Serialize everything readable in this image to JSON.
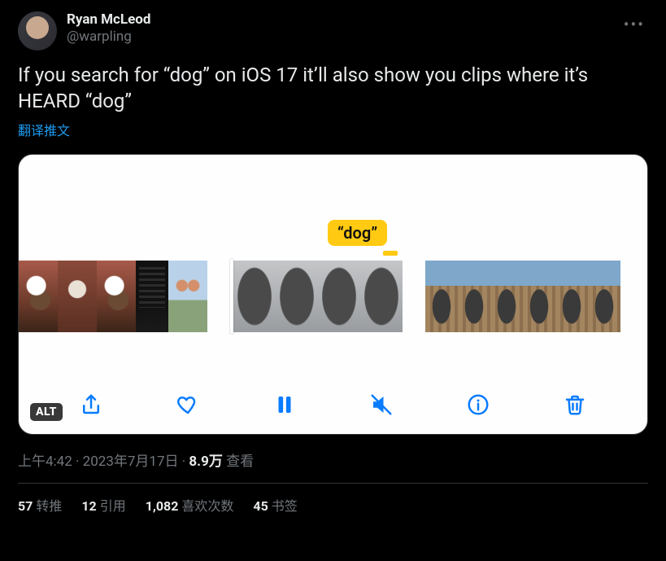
{
  "author": {
    "display_name": "Ryan McLeod",
    "handle": "@warpling"
  },
  "tweet_text": "If you search for “dog” on iOS 17 it’ll also show you clips where it’s HEARD “dog”",
  "translate_label": "翻译推文",
  "media": {
    "badge_text": "“dog”",
    "alt_label": "ALT",
    "tools": {
      "share": "share-icon",
      "like": "heart-icon",
      "pause": "pause-icon",
      "mute": "mute-icon",
      "info": "info-icon",
      "trash": "trash-icon"
    }
  },
  "meta": {
    "time": "上午4:42",
    "date": "2023年7月17日",
    "separator": " · ",
    "views_count": "8.9万",
    "views_label": " 查看"
  },
  "stats": {
    "retweets_count": "57",
    "retweets_label": "转推",
    "quotes_count": "12",
    "quotes_label": "引用",
    "likes_count": "1,082",
    "likes_label": "喜欢次数",
    "bookmarks_count": "45",
    "bookmarks_label": "书签"
  }
}
